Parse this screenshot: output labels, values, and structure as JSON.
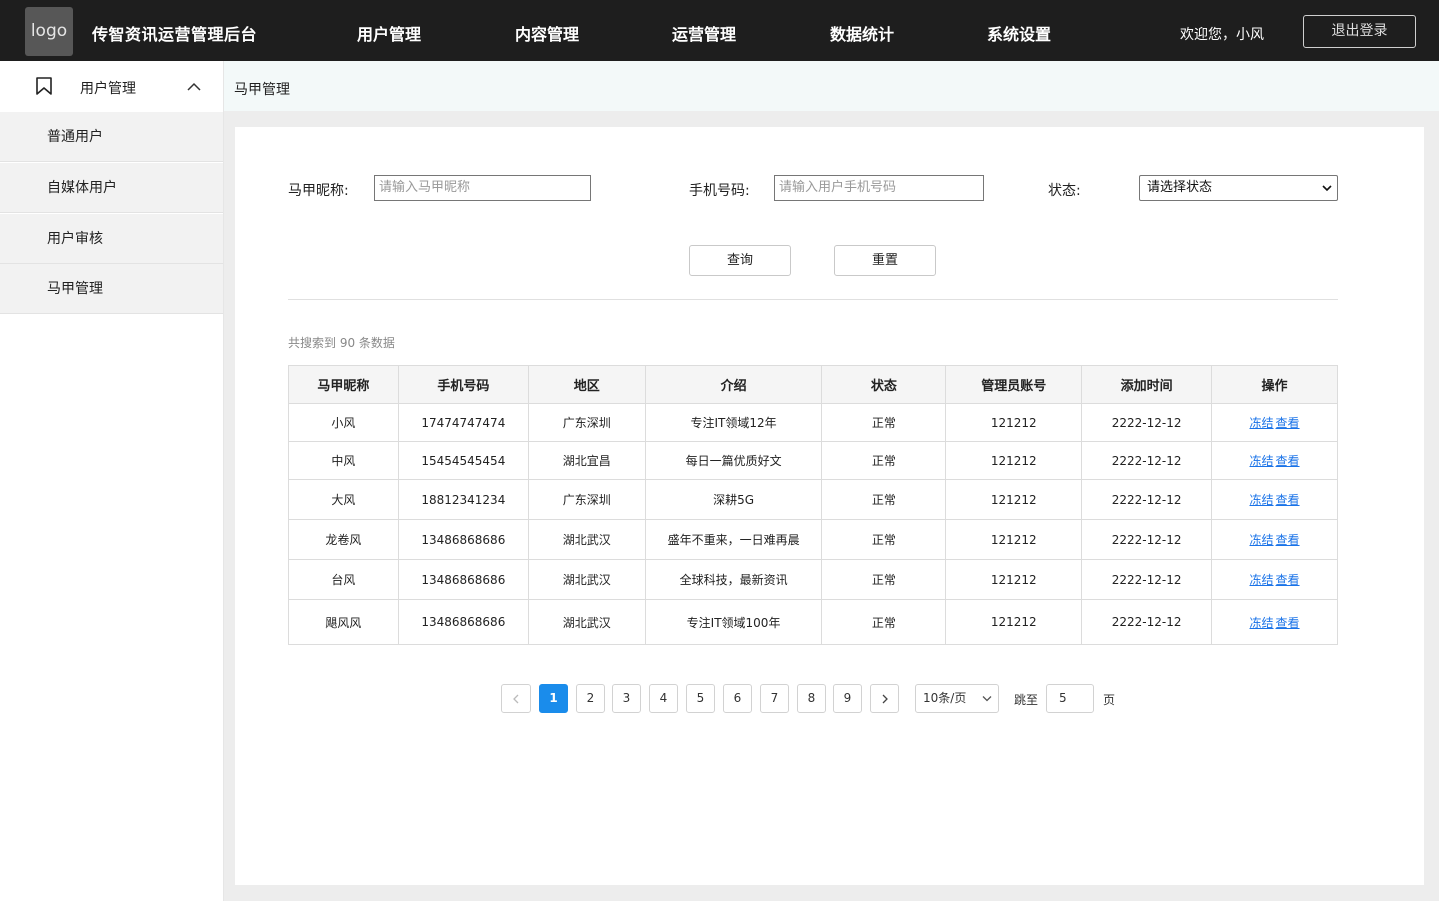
{
  "header": {
    "logo_text": "logo",
    "app_title": "传智资讯运营管理后台",
    "nav": [
      "用户管理",
      "内容管理",
      "运营管理",
      "数据统计",
      "系统设置"
    ],
    "welcome": "欢迎您，小风",
    "logout_label": "退出登录"
  },
  "sidebar": {
    "group_label": "用户管理",
    "items": [
      "普通用户",
      "自媒体用户",
      "用户审核",
      "马甲管理"
    ]
  },
  "breadcrumb": "马甲管理",
  "filters": {
    "nickname_label": "马甲昵称:",
    "nickname_placeholder": "请输入马甲昵称",
    "phone_label": "手机号码:",
    "phone_placeholder": "请输入用户手机号码",
    "status_label": "状态:",
    "status_selected": "请选择状态",
    "query_label": "查询",
    "reset_label": "重置"
  },
  "result_count": "共搜索到 90 条数据",
  "table": {
    "columns": [
      "马甲昵称",
      "手机号码",
      "地区",
      "介绍",
      "状态",
      "管理员账号",
      "添加时间",
      "操作"
    ],
    "rows": [
      [
        "小风",
        "17474747474",
        "广东深圳",
        "专注IT领域12年",
        "正常",
        "121212",
        "2222-12-12"
      ],
      [
        "中风",
        "15454545454",
        "湖北宜昌",
        "每日一篇优质好文",
        "正常",
        "121212",
        "2222-12-12"
      ],
      [
        "大风",
        "18812341234",
        "广东深圳",
        "深耕5G",
        "正常",
        "121212",
        "2222-12-12"
      ],
      [
        "龙卷风",
        "13486868686",
        "湖北武汉",
        "盛年不重来，一日难再晨",
        "正常",
        "121212",
        "2222-12-12"
      ],
      [
        "台风",
        "13486868686",
        "湖北武汉",
        "全球科技，最新资讯",
        "正常",
        "121212",
        "2222-12-12"
      ],
      [
        "飓风风",
        "13486868686",
        "湖北武汉",
        "专注IT领域100年",
        "正常",
        "121212",
        "2222-12-12"
      ]
    ],
    "action_freeze": "冻结",
    "action_view": "查看"
  },
  "pagination": {
    "pages": [
      "1",
      "2",
      "3",
      "4",
      "5",
      "6",
      "7",
      "8",
      "9"
    ],
    "current": "1",
    "per_page": "10条/页",
    "jump_label": "跳至",
    "jump_value": "5",
    "page_unit": "页"
  }
}
